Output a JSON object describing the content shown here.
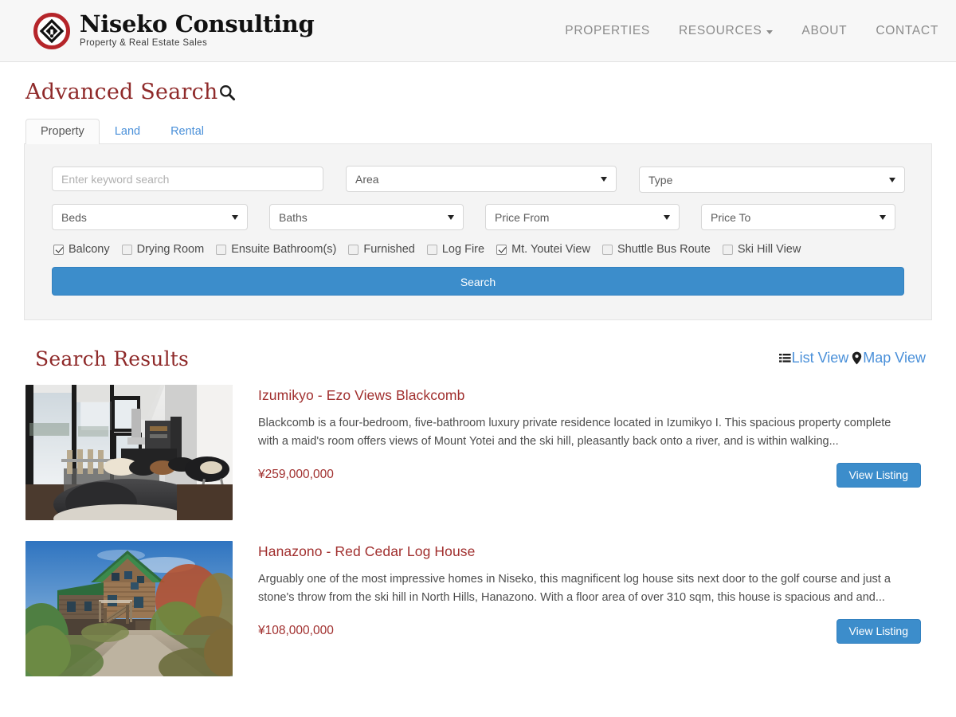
{
  "header": {
    "brand_name": "Niseko Consulting",
    "brand_tagline": "Property & Real Estate Sales",
    "logo_icon": "niseko-diamond-logo",
    "nav": [
      {
        "label": "PROPERTIES",
        "has_dropdown": false
      },
      {
        "label": "RESOURCES",
        "has_dropdown": true
      },
      {
        "label": "ABOUT",
        "has_dropdown": false
      },
      {
        "label": "CONTACT",
        "has_dropdown": false
      }
    ]
  },
  "page": {
    "title": "Advanced Search",
    "title_icon": "magnifier-icon"
  },
  "tabs": [
    {
      "label": "Property",
      "active": true
    },
    {
      "label": "Land",
      "active": false
    },
    {
      "label": "Rental",
      "active": false
    }
  ],
  "search_form": {
    "keyword": {
      "value": "",
      "placeholder": "Enter keyword search"
    },
    "area": {
      "selected": "Area"
    },
    "type": {
      "selected": "Type"
    },
    "beds": {
      "selected": "Beds"
    },
    "baths": {
      "selected": "Baths"
    },
    "price_from": {
      "selected": "Price From"
    },
    "price_to": {
      "selected": "Price To"
    },
    "features": [
      {
        "label": "Balcony",
        "checked": true
      },
      {
        "label": "Drying Room",
        "checked": false
      },
      {
        "label": "Ensuite Bathroom(s)",
        "checked": false
      },
      {
        "label": "Furnished",
        "checked": false
      },
      {
        "label": "Log Fire",
        "checked": false
      },
      {
        "label": "Mt. Youtei View",
        "checked": true
      },
      {
        "label": "Shuttle Bus Route",
        "checked": false
      },
      {
        "label": "Ski Hill View",
        "checked": false
      }
    ],
    "submit_label": "Search"
  },
  "results": {
    "heading": "Search Results",
    "view_modes": [
      {
        "label": "List View",
        "icon": "list-icon",
        "active": true
      },
      {
        "label": "Map View",
        "icon": "map-pin-icon",
        "active": false
      }
    ],
    "listings": [
      {
        "title": "Izumikyo - Ezo Views Blackcomb",
        "description": "Blackcomb is a four-bedroom, five-bathroom luxury private residence located in Izumikyo I. This spacious property complete with a maid's room offers views of Mount Yotei and the ski hill, pleasantly back onto a river, and is within walking...",
        "price": "¥259,000,000",
        "cta_label": "View Listing",
        "image_alt": "modern-living-room-interior"
      },
      {
        "title": "Hanazono - Red Cedar Log House",
        "description": "Arguably one of the most impressive homes in Niseko, this magnificent log house sits next door to the golf course and just a stone's throw from the ski hill in North Hills, Hanazono. With a floor area of over 310 sqm, this house is spacious and and...",
        "price": "¥108,000,000",
        "cta_label": "View Listing",
        "image_alt": "red-cedar-log-house-exterior"
      }
    ]
  },
  "colors": {
    "brand_red": "#b5252a",
    "heading_red": "#8f2a2a",
    "link_blue": "#4a90d9",
    "button_blue": "#3c8dcb",
    "panel_bg": "#f4f4f4",
    "header_bg": "#f7f7f7"
  }
}
